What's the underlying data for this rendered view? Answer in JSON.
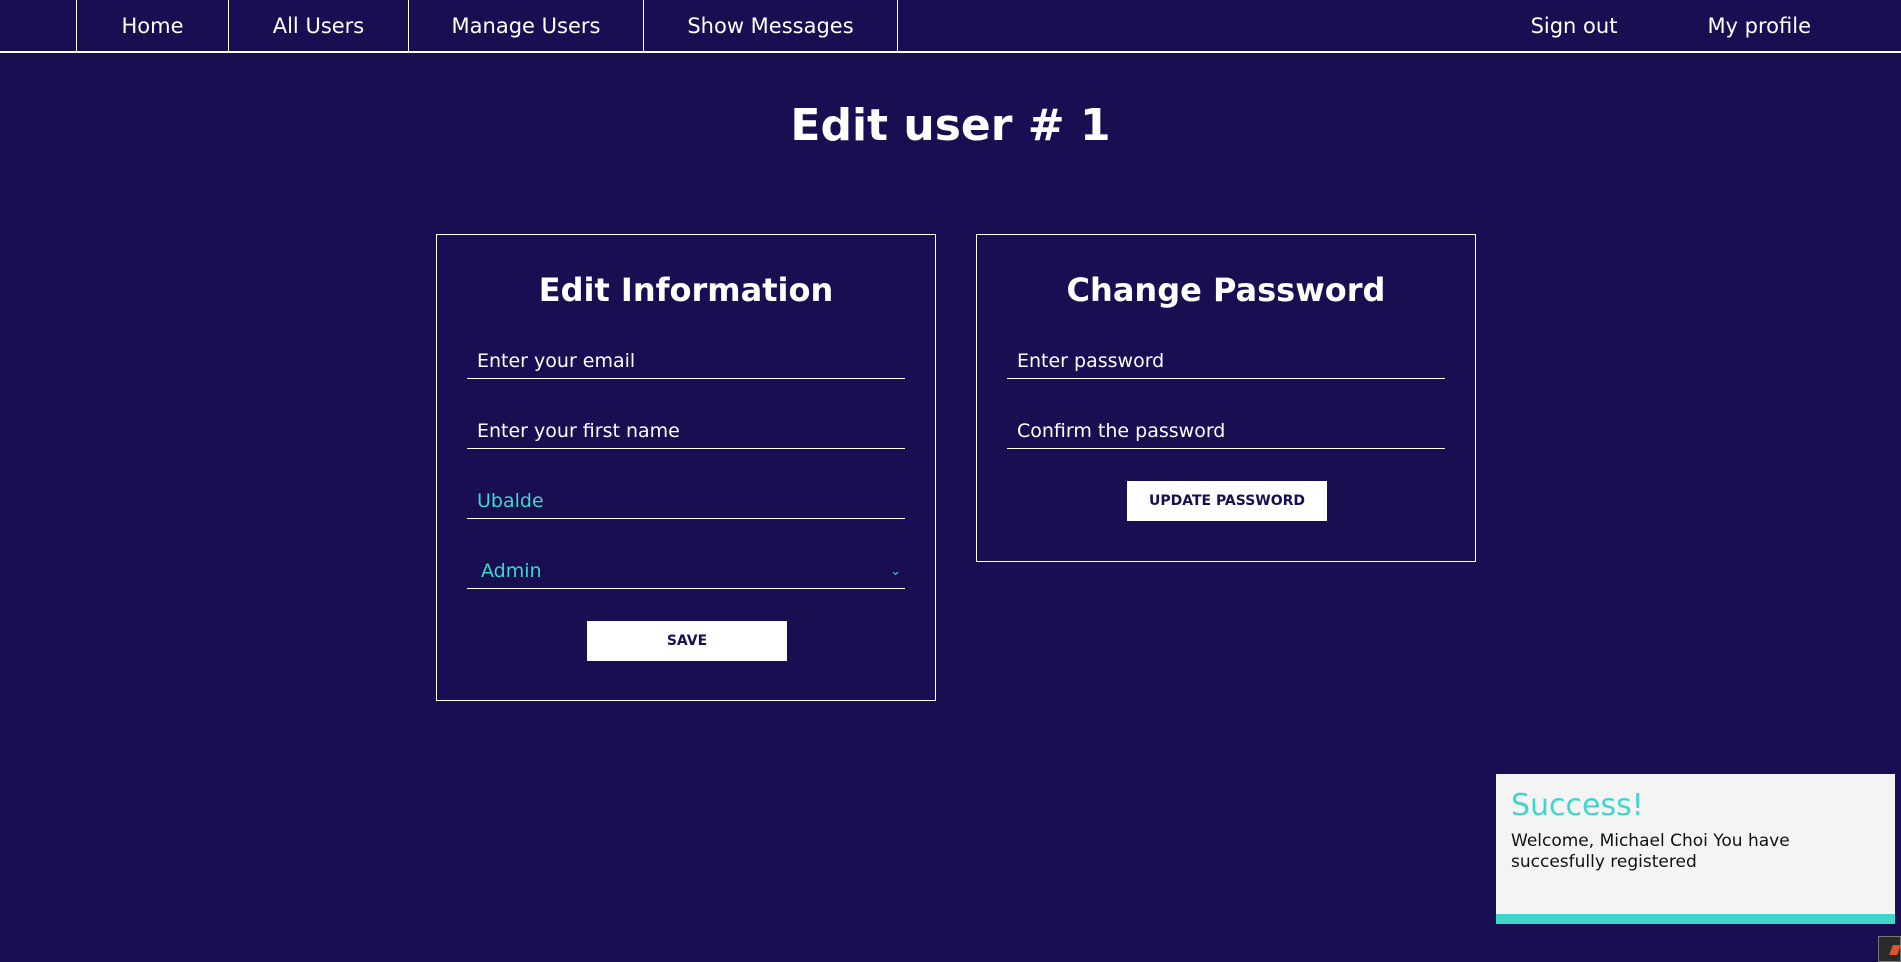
{
  "nav": {
    "left": [
      "Home",
      "All Users",
      "Manage Users",
      "Show Messages"
    ],
    "right": [
      "Sign out",
      "My profile"
    ]
  },
  "page_title": "Edit user # 1",
  "edit_info": {
    "heading": "Edit Information",
    "email_placeholder": "Enter your email",
    "first_name_placeholder": "Enter your first name",
    "last_name_value": "Ubalde",
    "role_value": "Admin",
    "save_label": "SAVE"
  },
  "change_password": {
    "heading": "Change Password",
    "password_placeholder": "Enter password",
    "confirm_placeholder": "Confirm the password",
    "update_label": "UPDATE PASSWORD"
  },
  "toast": {
    "title": "Success!",
    "message": "Welcome, Michael Choi You have succesfully registered"
  },
  "colors": {
    "background": "#1a0e52",
    "accent": "#3fd6cc",
    "toast_bg": "#f4f4f4"
  }
}
